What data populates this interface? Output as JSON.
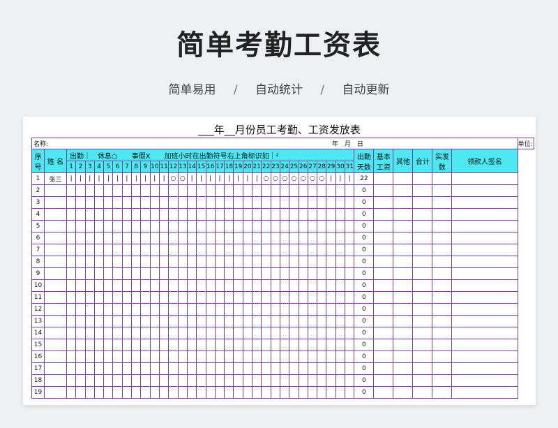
{
  "hero": {
    "title": "简单考勤工资表",
    "features": [
      "简单易用",
      "自动统计",
      "自动更新"
    ],
    "separator": "/"
  },
  "sheet": {
    "title": "___年__月份员工考勤、工资发放表",
    "name_label": "名称:",
    "date_label": "年　月　日",
    "unit_label": "单位: 元",
    "headers": {
      "seq": "序号",
      "name": "姓 名",
      "legend": "出勤｜　休息○　　事假X　　加班小时在出勤符号右上角标识如｜²",
      "days_attended": "出勤天数",
      "base_pay": "基本工资",
      "other": "其他",
      "total": "合计",
      "actual_pay": "实发数",
      "signature": "领款人签名"
    },
    "days": [
      "1",
      "2",
      "3",
      "4",
      "5",
      "6",
      "7",
      "8",
      "9",
      "10",
      "11",
      "12",
      "13",
      "14",
      "15",
      "16",
      "17",
      "18",
      "19",
      "20",
      "21",
      "22",
      "23",
      "24",
      "25",
      "26",
      "27",
      "28",
      "29",
      "30",
      "31"
    ],
    "rows": [
      {
        "seq": "1",
        "name": "张三",
        "marks": [
          "|",
          "|",
          "|",
          "|",
          "|",
          "|",
          "|",
          "|",
          "|",
          "|",
          "|",
          "○",
          "○",
          "|",
          "|",
          "|",
          "|",
          "|",
          "|",
          "|",
          "|",
          "○",
          "○",
          "○",
          "○",
          "○",
          "○",
          "○",
          "|",
          "|",
          "|"
        ],
        "days_attended": "22"
      },
      {
        "seq": "2",
        "name": "",
        "marks": [],
        "days_attended": "0"
      },
      {
        "seq": "3",
        "name": "",
        "marks": [],
        "days_attended": "0"
      },
      {
        "seq": "4",
        "name": "",
        "marks": [],
        "days_attended": "0"
      },
      {
        "seq": "5",
        "name": "",
        "marks": [],
        "days_attended": "0"
      },
      {
        "seq": "6",
        "name": "",
        "marks": [],
        "days_attended": "0"
      },
      {
        "seq": "7",
        "name": "",
        "marks": [],
        "days_attended": "0"
      },
      {
        "seq": "8",
        "name": "",
        "marks": [],
        "days_attended": "0"
      },
      {
        "seq": "9",
        "name": "",
        "marks": [],
        "days_attended": "0"
      },
      {
        "seq": "10",
        "name": "",
        "marks": [],
        "days_attended": "0"
      },
      {
        "seq": "11",
        "name": "",
        "marks": [],
        "days_attended": "0"
      },
      {
        "seq": "12",
        "name": "",
        "marks": [],
        "days_attended": "0"
      },
      {
        "seq": "13",
        "name": "",
        "marks": [],
        "days_attended": "0"
      },
      {
        "seq": "14",
        "name": "",
        "marks": [],
        "days_attended": "0"
      },
      {
        "seq": "15",
        "name": "",
        "marks": [],
        "days_attended": "0"
      },
      {
        "seq": "16",
        "name": "",
        "marks": [],
        "days_attended": "0"
      },
      {
        "seq": "17",
        "name": "",
        "marks": [],
        "days_attended": "0"
      },
      {
        "seq": "18",
        "name": "",
        "marks": [],
        "days_attended": "0"
      },
      {
        "seq": "19",
        "name": "",
        "marks": [],
        "days_attended": "0"
      }
    ],
    "colors": {
      "header_fill": "#4de8f2",
      "grid_line": "#7b3fa0"
    }
  }
}
